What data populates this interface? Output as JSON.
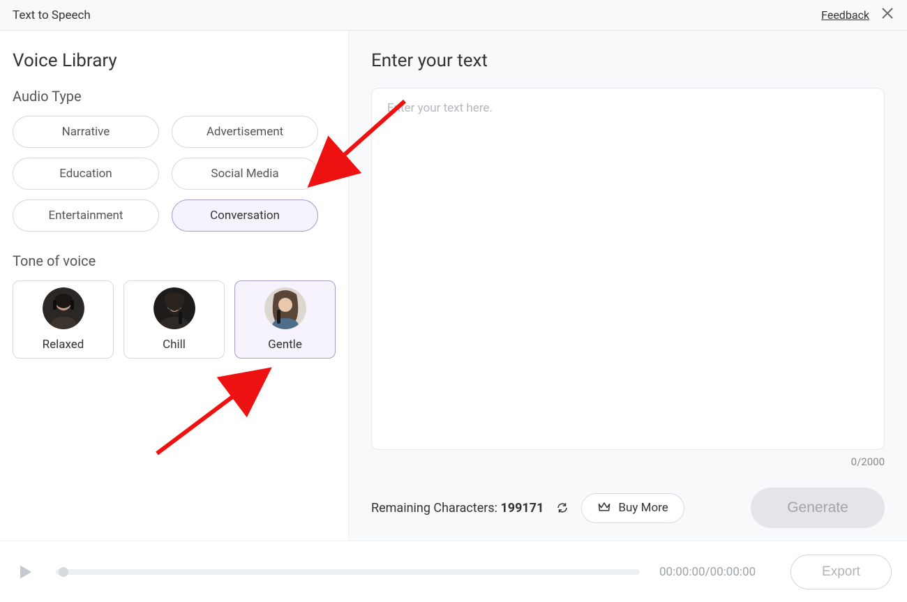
{
  "header": {
    "title": "Text to Speech",
    "feedback": "Feedback"
  },
  "sidebar": {
    "library_title": "Voice Library",
    "audio_type_label": "Audio Type",
    "audio_types": [
      {
        "label": "Narrative",
        "selected": false
      },
      {
        "label": "Advertisement",
        "selected": false
      },
      {
        "label": "Education",
        "selected": false
      },
      {
        "label": "Social Media",
        "selected": false
      },
      {
        "label": "Entertainment",
        "selected": false
      },
      {
        "label": "Conversation",
        "selected": true
      }
    ],
    "tone_label": "Tone of voice",
    "tones": [
      {
        "label": "Relaxed",
        "selected": false
      },
      {
        "label": "Chill",
        "selected": false
      },
      {
        "label": "Gentle",
        "selected": true
      }
    ]
  },
  "main": {
    "enter_text_label": "Enter your text",
    "placeholder": "Enter your text here.",
    "char_counter": "0/2000",
    "remaining_label": "Remaining Characters:",
    "remaining_value": "199171",
    "buy_more_label": "Buy More",
    "generate_label": "Generate"
  },
  "footer": {
    "time": "00:00:00/00:00:00",
    "export_label": "Export"
  }
}
